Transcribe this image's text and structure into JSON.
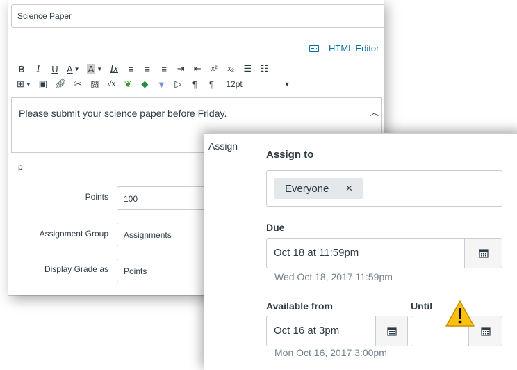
{
  "editor": {
    "title_value": "Science Paper",
    "html_editor_label": "HTML Editor",
    "toolbar_row1": [
      "B",
      "I",
      "U",
      "A",
      "A",
      "Ix",
      "align-left",
      "align-center",
      "align-right",
      "indent",
      "outdent",
      "x²",
      "x₂",
      "bullet-list",
      "numbered-list"
    ],
    "font_size": "12pt",
    "body_text": "Please submit your science paper before Friday.",
    "path_element": "p"
  },
  "fields": {
    "points_label": "Points",
    "points_value": "100",
    "group_label": "Assignment Group",
    "group_value": "Assignments",
    "display_label": "Display Grade as",
    "display_value": "Points"
  },
  "assign": {
    "side_label": "Assign",
    "assign_to_label": "Assign to",
    "token_label": "Everyone",
    "token_remove": "×",
    "due_label": "Due",
    "due_value": "Oct 18 at 11:59pm",
    "due_hint": "Wed Oct 18, 2017 11:59pm",
    "available_label": "Available from",
    "available_value": "Oct 16 at 3pm",
    "available_hint": "Mon Oct 16, 2017 3:00pm",
    "until_label": "Until",
    "until_value": ""
  },
  "colors": {
    "link": "#0770a3",
    "warning": "#fdc010",
    "border": "#c7cdd1"
  }
}
